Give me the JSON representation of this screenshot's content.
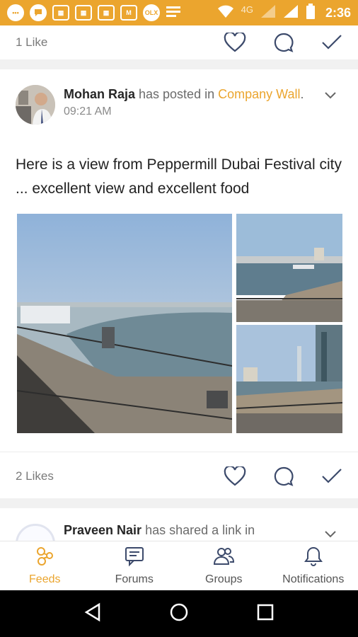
{
  "status_bar": {
    "icons": [
      "chat-icon",
      "message-icon",
      "calendar-icon",
      "calendar-icon",
      "calendar-icon",
      "gmail-icon",
      "olx-icon",
      "news-icon",
      "wifi-icon",
      "signal-icon",
      "battery-icon"
    ],
    "network": "4G",
    "time": "2:36",
    "color": "#eba52e"
  },
  "feed": {
    "prev_post": {
      "likes": "1 Like"
    },
    "post": {
      "author": "Mohan Raja",
      "action": " has posted in ",
      "wall": "Company Wall",
      "wall_suffix": ".",
      "time": "09:21 AM",
      "text": "Here is a view from Peppermill Dubai Festival city ... excellent view and excellent food",
      "likes": "2 Likes"
    },
    "next_post": {
      "author": "Praveen Nair",
      "action": " has shared a link in"
    }
  },
  "bottom_nav": {
    "items": [
      {
        "label": "Feeds",
        "icon": "feeds-icon",
        "active": true
      },
      {
        "label": "Forums",
        "icon": "forums-icon",
        "active": false
      },
      {
        "label": "Groups",
        "icon": "groups-icon",
        "active": false
      },
      {
        "label": "Notifications",
        "icon": "bell-icon",
        "active": false
      }
    ]
  },
  "colors": {
    "accent": "#eba52e",
    "text": "#222222",
    "muted": "#7a7a7a"
  }
}
